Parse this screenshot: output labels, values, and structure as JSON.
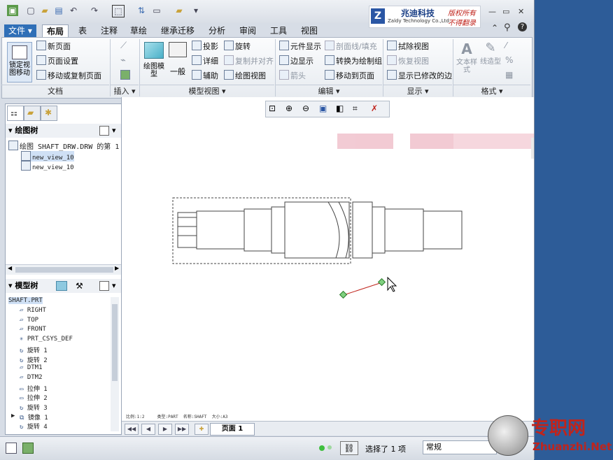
{
  "qat": {
    "icons": [
      "app-icon",
      "new-icon",
      "open-icon",
      "save-icon",
      "undo-icon",
      "redo-icon",
      "select-icon",
      "regen-icon",
      "windows-icon",
      "folder-icon",
      "more-icon"
    ]
  },
  "brand": {
    "name": "兆迪科技",
    "english": "Zaldy Technology Co.,Ltd.",
    "slogan1": "版权所有",
    "slogan2": "不得翻录"
  },
  "tabs": [
    "文件",
    "布局",
    "表",
    "注释",
    "草绘",
    "继承迁移",
    "分析",
    "审阅",
    "工具",
    "视图"
  ],
  "ribbon": {
    "lock_view": "锁定视图移动",
    "new_page": "新页面",
    "page_setup": "页面设置",
    "move_copy_page": "移动或复制页面",
    "drawing_model": "绘图模型",
    "general": "一般",
    "projection": "投影",
    "detail": "详细",
    "auxiliary": "辅助",
    "revolve": "旋转",
    "copy_align": "复制并对齐",
    "drawing_view": "绘图视图",
    "element_display": "元件显示",
    "edge_display": "边显示",
    "arrow": "箭头",
    "section_line": "剖面线/填充",
    "convert_to_drawing": "转换为绘制组",
    "move_to_page": "移动到页面",
    "erase_view": "拭除视图",
    "restore_view": "恢复视图",
    "show_modified_edges": "显示已修改的边",
    "text_style": "文本样式",
    "line_style": "线造型",
    "groups": {
      "document": "文档",
      "insert": "插入",
      "model_views": "模型视图",
      "edit": "编辑",
      "display": "显示",
      "format": "格式"
    }
  },
  "drawing_tree": {
    "title": "绘图树",
    "root": "绘图 SHAFT_DRW.DRW 的第 1 页",
    "items": [
      "new_view_10",
      "new_view_10"
    ]
  },
  "model_tree": {
    "title": "模型树",
    "root": "SHAFT.PRT",
    "items": [
      "RIGHT",
      "TOP",
      "FRONT",
      "PRT_CSYS_DEF",
      "旋转 1",
      "旋转 2",
      "DTM1",
      "DTM2",
      "拉伸 1",
      "拉伸 2",
      "旋转 3",
      "镜像 1",
      "旋转 4"
    ]
  },
  "canvas": {
    "bottom_info": "比例:1:2     类型:PART  名称:SHAFT  大小:A3"
  },
  "pagebar": {
    "page_label": "页面 1"
  },
  "status": {
    "selected": "选择了 1 项",
    "filter": "常规"
  },
  "watermark": {
    "cn": "专职网",
    "url": "Zhuanzhi.Net"
  }
}
